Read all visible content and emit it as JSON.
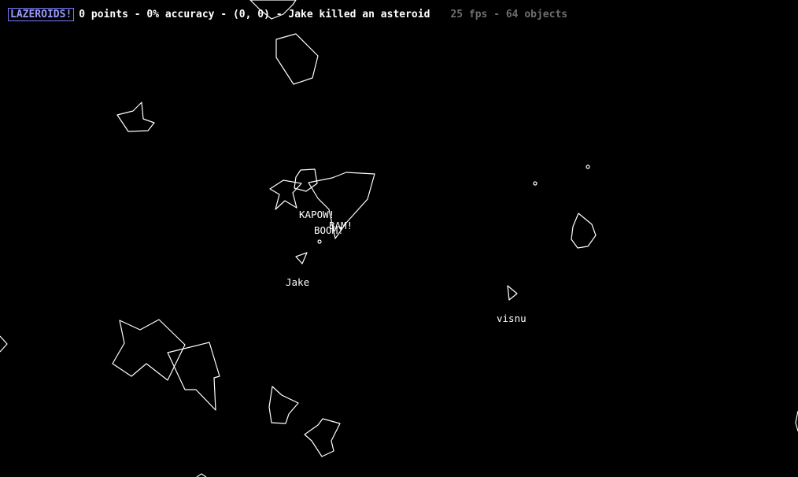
{
  "hud": {
    "game_title": "LAZEROIDS!",
    "status": "0 points - 0% accuracy - (0, 0) - Jake killed an asteroid",
    "perf": "25 fps - 64 objects"
  },
  "players": [
    {
      "name": "Jake"
    },
    {
      "name": "visnu"
    }
  ],
  "effects": [
    {
      "text": "KAPOW!"
    },
    {
      "text": "BAM!"
    },
    {
      "text": "BOOM!"
    }
  ],
  "colors": {
    "background": "#000000",
    "stroke": "#ffffff",
    "badge": "#9a9aff",
    "perf": "#6e6e6e"
  }
}
